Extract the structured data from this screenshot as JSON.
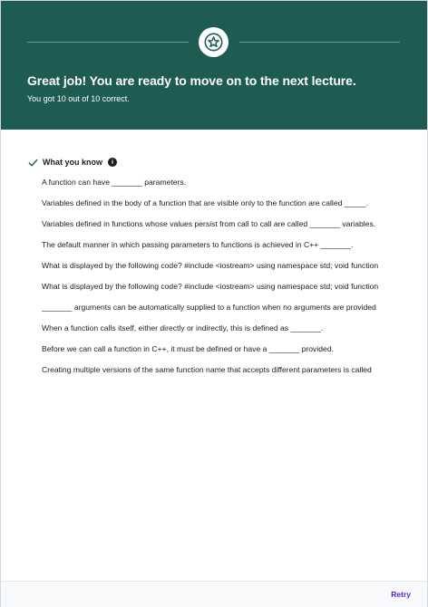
{
  "banner": {
    "title": "Great job! You are ready to move on to the next lecture.",
    "subtitle": "You got 10 out of 10 correct.",
    "badge_icon": "star-icon",
    "background_color": "#1e5b53"
  },
  "section": {
    "title": "What you know",
    "status_icon": "check-icon",
    "info_icon": "info-icon"
  },
  "questions": [
    "A function can have _______ parameters.",
    "Variables defined in the body of a function that are visible only to the function are called _____.",
    "Variables defined in functions whose values persist from call to call are called _______ variables.",
    "The default manner in which passing parameters to functions is achieved in C++ _______.",
    "What is displayed by the following code? #include <iostream> using namespace std; void function",
    "What is displayed by the following code? #include <iostream> using namespace std; void function",
    "_______ arguments can be automatically supplied to a function when no arguments are provided",
    "When a function calls itself, either directly or indirectly, this is defined as _______.",
    "Before we can call a function in C++, it must be defined or have a _______ provided.",
    "Creating multiple versions of the same function name that accepts different parameters is called"
  ],
  "footer": {
    "retry_label": "Retry",
    "accent_color": "#5624d0"
  }
}
